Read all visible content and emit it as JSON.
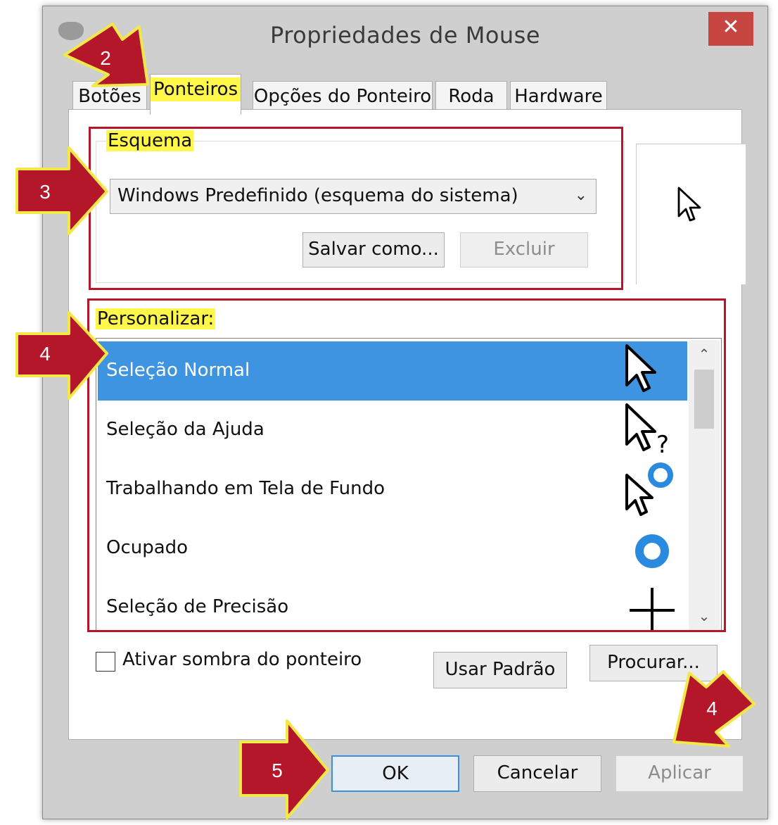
{
  "window": {
    "title": "Propriedades de Mouse",
    "close_glyph": "✕"
  },
  "tabs": [
    {
      "label": "Botões"
    },
    {
      "label": "Ponteiros"
    },
    {
      "label": "Opções do Ponteiro"
    },
    {
      "label": "Roda"
    },
    {
      "label": "Hardware"
    }
  ],
  "scheme": {
    "legend": "Esquema",
    "selected": "Windows Predefinido (esquema do sistema)",
    "save_as_label": "Salvar como...",
    "delete_label": "Excluir"
  },
  "customize": {
    "label": "Personalizar:",
    "items": [
      {
        "label": "Seleção Normal",
        "icon": "arrow-cursor-icon",
        "selected": true
      },
      {
        "label": "Seleção da Ajuda",
        "icon": "help-cursor-icon"
      },
      {
        "label": "Trabalhando em Tela de Fundo",
        "icon": "working-cursor-icon"
      },
      {
        "label": "Ocupado",
        "icon": "busy-cursor-icon"
      },
      {
        "label": "Seleção de Precisão",
        "icon": "crosshair-cursor-icon"
      }
    ]
  },
  "shadow_checkbox": {
    "label": "Ativar sombra do ponteiro",
    "checked": false
  },
  "buttons": {
    "use_default": "Usar Padrão",
    "browse": "Procurar...",
    "ok": "OK",
    "cancel": "Cancelar",
    "apply": "Aplicar"
  },
  "callouts": {
    "c2": "2",
    "c3": "3",
    "c4a": "4",
    "c4b": "4",
    "c5": "5"
  },
  "colors": {
    "highlight": "#fff84a",
    "selection": "#3e94e0",
    "annotation_red": "#b5172a",
    "close_button": "#c74642"
  }
}
